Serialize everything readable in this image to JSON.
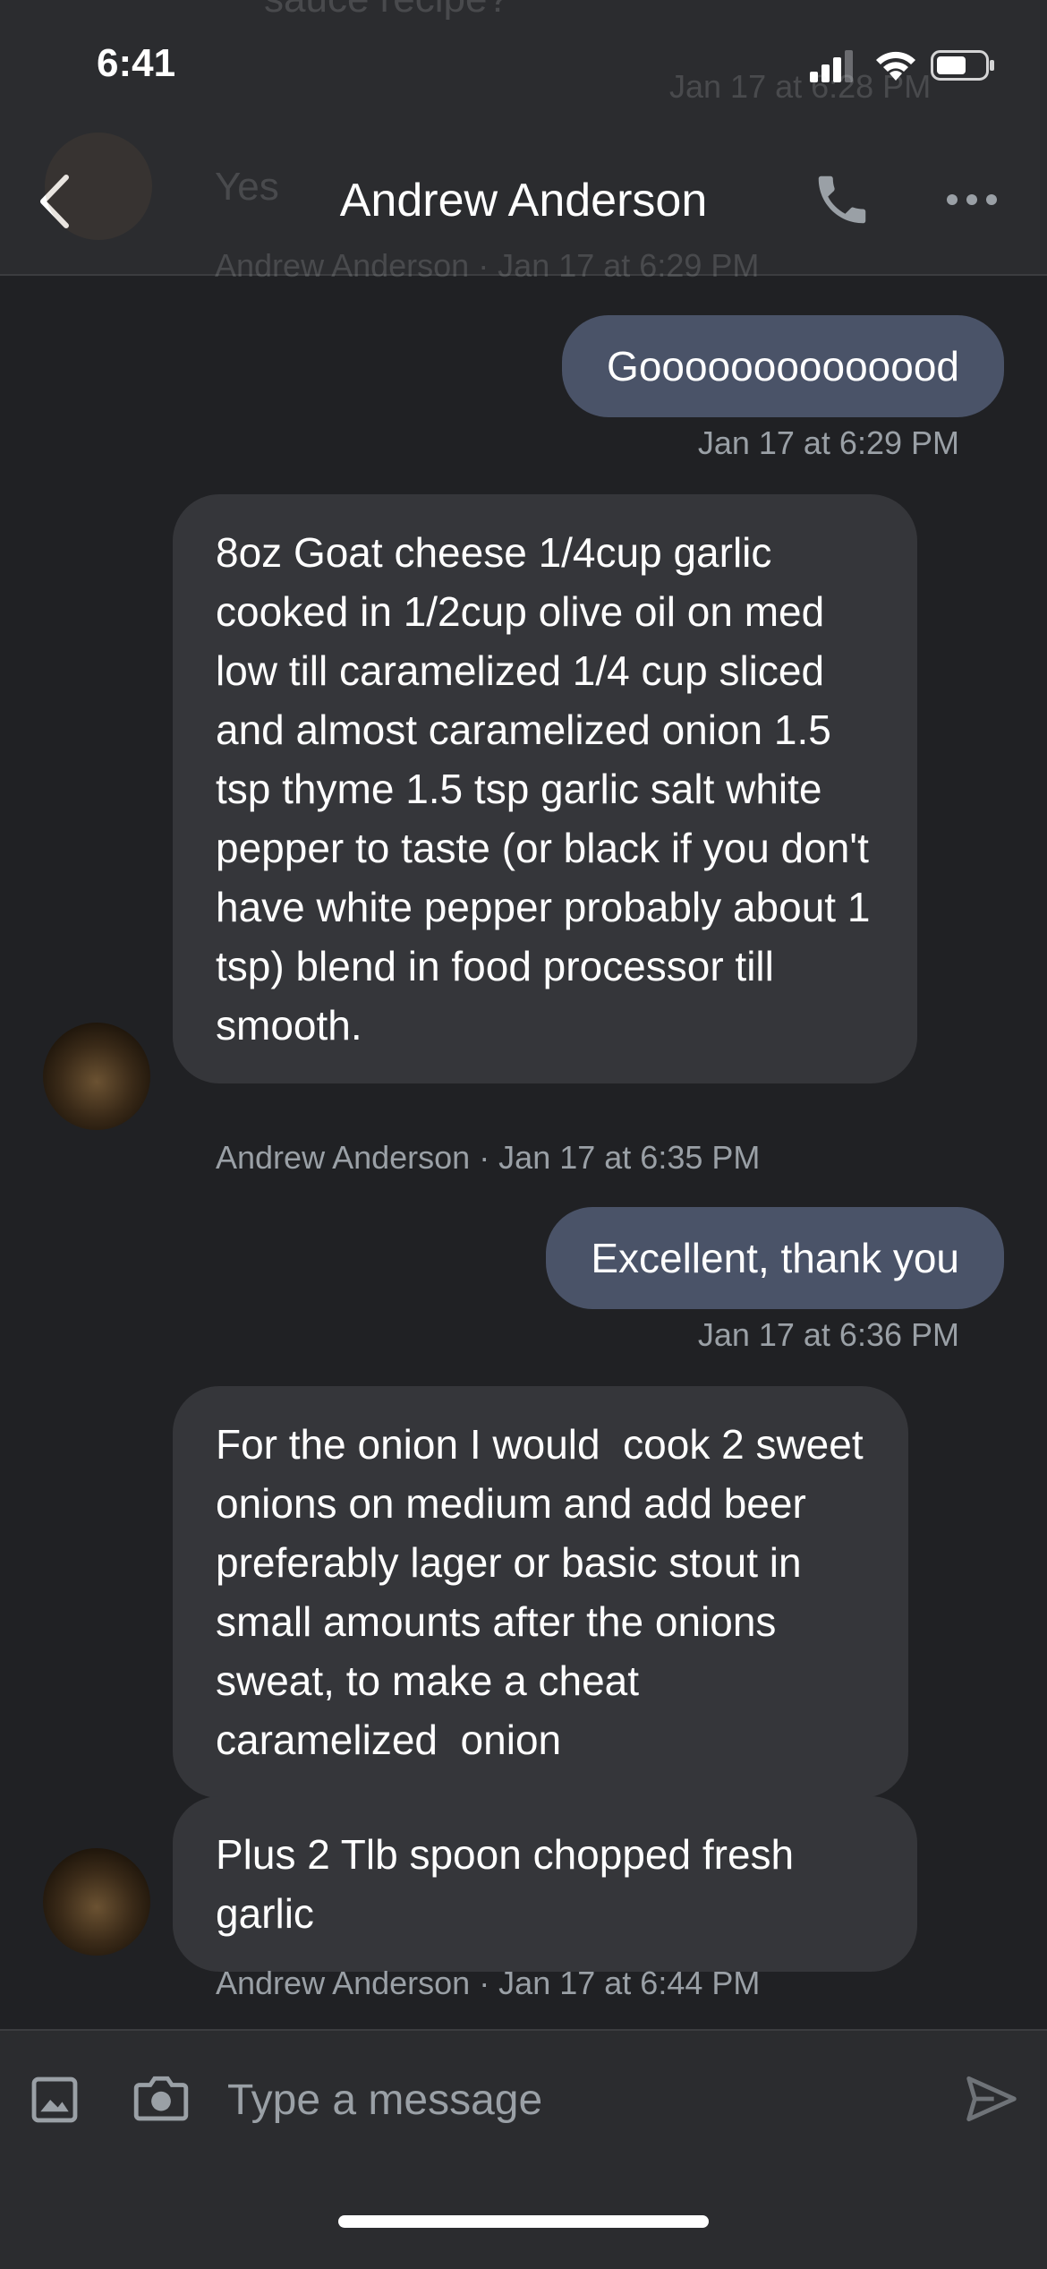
{
  "status_bar": {
    "time": "6:41"
  },
  "background_ghost": {
    "prev_message_fragment": "sauce recipe?",
    "prev_timestamp": "Jan 17 at 6:28 PM",
    "reply_fragment": "Yes",
    "reply_meta": "Andrew Anderson · Jan 17 at 6:29 PM"
  },
  "header": {
    "title": "Andrew Anderson"
  },
  "messages": [
    {
      "direction": "outgoing",
      "text": "Goooooooooooood",
      "meta": "Jan 17 at 6:29 PM"
    },
    {
      "direction": "incoming",
      "text": "8oz Goat cheese 1/4cup garlic cooked in 1/2cup olive oil on med low till caramelized 1/4 cup sliced and almost caramelized onion 1.5 tsp thyme 1.5 tsp garlic salt white pepper to taste (or black if you don't have white pepper probably about 1 tsp) blend in food processor till smooth.",
      "meta": "Andrew Anderson · Jan 17 at 6:35 PM"
    },
    {
      "direction": "outgoing",
      "text": "Excellent, thank you",
      "meta": "Jan 17 at 6:36 PM"
    },
    {
      "direction": "incoming",
      "text": "For the onion I would  cook 2 sweet onions on medium and add beer preferably lager or basic stout in small amounts after the onions sweat, to make a cheat caramelized  onion",
      "meta": ""
    },
    {
      "direction": "incoming",
      "text": "Plus 2 Tlb spoon chopped fresh garlic",
      "meta": "Andrew Anderson · Jan 17 at 6:44 PM"
    }
  ],
  "composer": {
    "placeholder": "Type a message"
  }
}
